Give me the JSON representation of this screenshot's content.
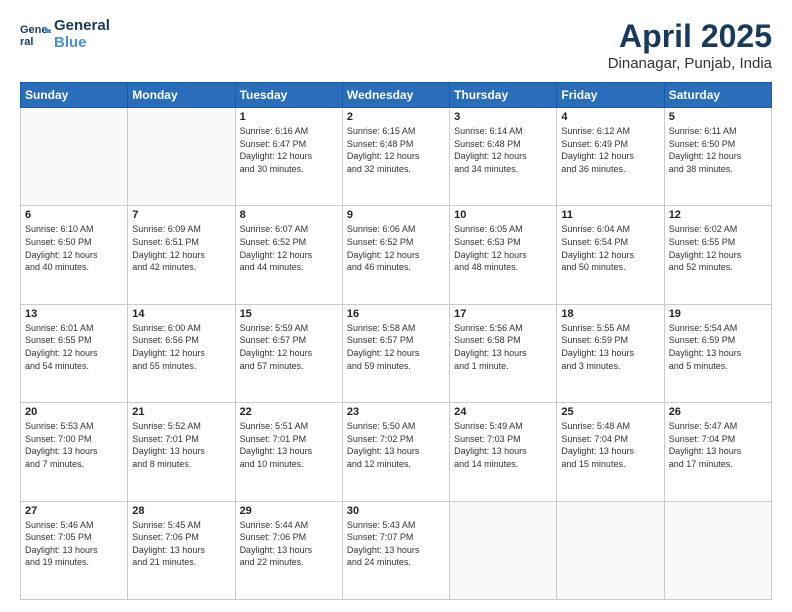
{
  "logo": {
    "line1": "General",
    "line2": "Blue"
  },
  "title": {
    "main": "April 2025",
    "sub": "Dinanagar, Punjab, India"
  },
  "weekdays": [
    "Sunday",
    "Monday",
    "Tuesday",
    "Wednesday",
    "Thursday",
    "Friday",
    "Saturday"
  ],
  "weeks": [
    [
      {
        "day": "",
        "info": ""
      },
      {
        "day": "",
        "info": ""
      },
      {
        "day": "1",
        "info": "Sunrise: 6:16 AM\nSunset: 6:47 PM\nDaylight: 12 hours\nand 30 minutes."
      },
      {
        "day": "2",
        "info": "Sunrise: 6:15 AM\nSunset: 6:48 PM\nDaylight: 12 hours\nand 32 minutes."
      },
      {
        "day": "3",
        "info": "Sunrise: 6:14 AM\nSunset: 6:48 PM\nDaylight: 12 hours\nand 34 minutes."
      },
      {
        "day": "4",
        "info": "Sunrise: 6:12 AM\nSunset: 6:49 PM\nDaylight: 12 hours\nand 36 minutes."
      },
      {
        "day": "5",
        "info": "Sunrise: 6:11 AM\nSunset: 6:50 PM\nDaylight: 12 hours\nand 38 minutes."
      }
    ],
    [
      {
        "day": "6",
        "info": "Sunrise: 6:10 AM\nSunset: 6:50 PM\nDaylight: 12 hours\nand 40 minutes."
      },
      {
        "day": "7",
        "info": "Sunrise: 6:09 AM\nSunset: 6:51 PM\nDaylight: 12 hours\nand 42 minutes."
      },
      {
        "day": "8",
        "info": "Sunrise: 6:07 AM\nSunset: 6:52 PM\nDaylight: 12 hours\nand 44 minutes."
      },
      {
        "day": "9",
        "info": "Sunrise: 6:06 AM\nSunset: 6:52 PM\nDaylight: 12 hours\nand 46 minutes."
      },
      {
        "day": "10",
        "info": "Sunrise: 6:05 AM\nSunset: 6:53 PM\nDaylight: 12 hours\nand 48 minutes."
      },
      {
        "day": "11",
        "info": "Sunrise: 6:04 AM\nSunset: 6:54 PM\nDaylight: 12 hours\nand 50 minutes."
      },
      {
        "day": "12",
        "info": "Sunrise: 6:02 AM\nSunset: 6:55 PM\nDaylight: 12 hours\nand 52 minutes."
      }
    ],
    [
      {
        "day": "13",
        "info": "Sunrise: 6:01 AM\nSunset: 6:55 PM\nDaylight: 12 hours\nand 54 minutes."
      },
      {
        "day": "14",
        "info": "Sunrise: 6:00 AM\nSunset: 6:56 PM\nDaylight: 12 hours\nand 55 minutes."
      },
      {
        "day": "15",
        "info": "Sunrise: 5:59 AM\nSunset: 6:57 PM\nDaylight: 12 hours\nand 57 minutes."
      },
      {
        "day": "16",
        "info": "Sunrise: 5:58 AM\nSunset: 6:57 PM\nDaylight: 12 hours\nand 59 minutes."
      },
      {
        "day": "17",
        "info": "Sunrise: 5:56 AM\nSunset: 6:58 PM\nDaylight: 13 hours\nand 1 minute."
      },
      {
        "day": "18",
        "info": "Sunrise: 5:55 AM\nSunset: 6:59 PM\nDaylight: 13 hours\nand 3 minutes."
      },
      {
        "day": "19",
        "info": "Sunrise: 5:54 AM\nSunset: 6:59 PM\nDaylight: 13 hours\nand 5 minutes."
      }
    ],
    [
      {
        "day": "20",
        "info": "Sunrise: 5:53 AM\nSunset: 7:00 PM\nDaylight: 13 hours\nand 7 minutes."
      },
      {
        "day": "21",
        "info": "Sunrise: 5:52 AM\nSunset: 7:01 PM\nDaylight: 13 hours\nand 8 minutes."
      },
      {
        "day": "22",
        "info": "Sunrise: 5:51 AM\nSunset: 7:01 PM\nDaylight: 13 hours\nand 10 minutes."
      },
      {
        "day": "23",
        "info": "Sunrise: 5:50 AM\nSunset: 7:02 PM\nDaylight: 13 hours\nand 12 minutes."
      },
      {
        "day": "24",
        "info": "Sunrise: 5:49 AM\nSunset: 7:03 PM\nDaylight: 13 hours\nand 14 minutes."
      },
      {
        "day": "25",
        "info": "Sunrise: 5:48 AM\nSunset: 7:04 PM\nDaylight: 13 hours\nand 15 minutes."
      },
      {
        "day": "26",
        "info": "Sunrise: 5:47 AM\nSunset: 7:04 PM\nDaylight: 13 hours\nand 17 minutes."
      }
    ],
    [
      {
        "day": "27",
        "info": "Sunrise: 5:46 AM\nSunset: 7:05 PM\nDaylight: 13 hours\nand 19 minutes."
      },
      {
        "day": "28",
        "info": "Sunrise: 5:45 AM\nSunset: 7:06 PM\nDaylight: 13 hours\nand 21 minutes."
      },
      {
        "day": "29",
        "info": "Sunrise: 5:44 AM\nSunset: 7:06 PM\nDaylight: 13 hours\nand 22 minutes."
      },
      {
        "day": "30",
        "info": "Sunrise: 5:43 AM\nSunset: 7:07 PM\nDaylight: 13 hours\nand 24 minutes."
      },
      {
        "day": "",
        "info": ""
      },
      {
        "day": "",
        "info": ""
      },
      {
        "day": "",
        "info": ""
      }
    ]
  ]
}
